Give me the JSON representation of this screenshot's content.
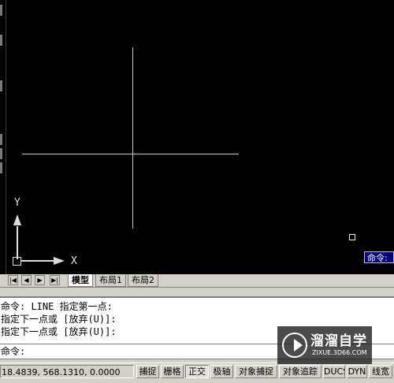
{
  "colors": {
    "canvas": "#000000",
    "crosshair": "#c8c8c8",
    "tip_bg": "#000080"
  },
  "ucs": {
    "y_label": "Y",
    "x_label": "X"
  },
  "cursor_tip": "命令:",
  "tabs": {
    "nav": [
      "|◀",
      "◀",
      "▶",
      "▶|"
    ],
    "model": "模型",
    "layout1": "布局1",
    "layout2": "布局2"
  },
  "command": {
    "history": [
      "命令:  LINE 指定第一点:",
      "指定下一点或 [放弃(U)]:",
      "指定下一点或 [放弃(U)]:"
    ],
    "prompt": "命令:"
  },
  "status": {
    "coords": "18.4839, 568.1310, 0.0000",
    "buttons": [
      "捕捉",
      "栅格",
      "正交",
      "极轴",
      "对象捕捉",
      "对象追踪",
      "DUCS",
      "DYN",
      "线宽"
    ]
  },
  "watermark": {
    "title": "溜溜自学",
    "url": "ZIXUE.3D66.COM"
  }
}
